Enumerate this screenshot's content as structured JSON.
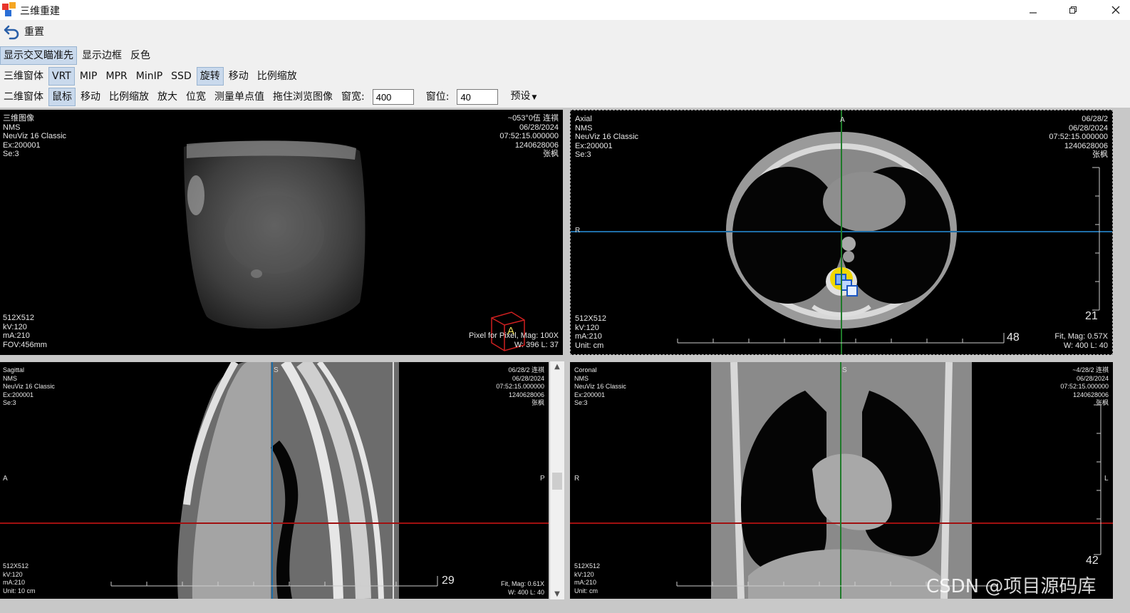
{
  "window": {
    "title": "三维重建"
  },
  "toolbar": {
    "reset_label": "重置"
  },
  "row1": {
    "items": [
      "显示交叉瞄准先",
      "显示边框",
      "反色"
    ],
    "active": [
      0
    ]
  },
  "row2": {
    "items": [
      "三维窗体",
      "VRT",
      "MIP",
      "MPR",
      "MinIP",
      "SSD",
      "旋转",
      "移动",
      "比例缩放"
    ],
    "active": [
      1,
      6
    ]
  },
  "row3": {
    "items": [
      "二维窗体",
      "鼠标",
      "移动",
      "比例缩放",
      "放大",
      "位宽",
      "测量单点值",
      "拖住浏览图像"
    ],
    "active": [
      1
    ],
    "window_width_label": "窗宽:",
    "window_width_value": "400",
    "window_level_label": "窗位:",
    "window_level_value": "40",
    "preset_label": "预设"
  },
  "panels": {
    "vr": {
      "top_left": "三维图像\nNMS\nNeuViz 16 Classic\nEx:200001\nSe:3",
      "top_right": "~053°0伍 连祺\n06/28/2024\n07:52:15.000000\n1240628006\n张枫",
      "bottom_left": "512X512\nkV:120\nmA:210\nFOV:456mm",
      "bottom_right": "Pixel for Pixel, Mag: 100X\nW: 396 L: 37",
      "cube_label": "A"
    },
    "axial": {
      "top_left": "Axial\nNMS\nNeuViz 16 Classic\nEx:200001\nSe:3",
      "top_right": "06/28/2\n06/28/2024\n07:52:15.000000\n1240628006\n张枫",
      "bottom_left": "512X512\nkV:120\nmA:210\nUnit: cm",
      "bottom_right": "Fit, Mag: 0.57X\nW: 400 L: 40",
      "slice_number": "21",
      "ruler_number": "48",
      "orient_top": "A",
      "orient_left": "R"
    },
    "sagittal": {
      "top_left": "Sagittal\nNMS\nNeuViz 16 Classic\nEx:200001\nSe:3",
      "top_right": "06/28/2 连祺\n06/28/2024\n07:52:15.000000\n1240628006\n张枫",
      "bottom_left": "512X512\nkV:120\nmA:210\nUnit: 10 cm",
      "bottom_right": "Fit, Mag: 0.61X\nW: 400 L: 40",
      "ruler_number": "29",
      "orient_left": "A",
      "orient_right": "P",
      "orient_top": "S"
    },
    "coronal": {
      "top_left": "Coronal\nNMS\nNeuViz 16 Classic\nEx:200001\nSe:3",
      "top_right": "~4/28/2 连祺\n06/28/2024\n07:52:15.000000\n1240628006\n张枫",
      "bottom_left": "512X512\nkV:120\nmA:210\nUnit: cm",
      "slice_number": "42",
      "orient_left": "R",
      "orient_right": "L",
      "orient_top": "S"
    }
  },
  "watermark": "CSDN @项目源码库",
  "colors": {
    "crosshair_blue": "#1e6ea8",
    "crosshair_red": "#a01010",
    "crosshair_green": "#1f7a2a",
    "active_button": "#c9d9ec"
  }
}
